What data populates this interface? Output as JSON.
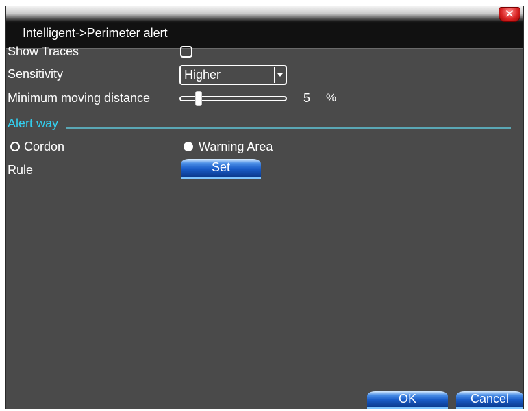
{
  "window": {
    "title": "Intelligent->Perimeter alert",
    "close_label": "✕"
  },
  "settings": {
    "show_traces": {
      "label": "Show Traces",
      "checked": false
    },
    "sensitivity": {
      "label": "Sensitivity",
      "value": "Higher"
    },
    "min_distance": {
      "label": "Minimum moving distance",
      "value": "5",
      "unit": "%",
      "level_percent": 5
    }
  },
  "alert_way": {
    "label": "Alert way",
    "options": [
      {
        "label": "Cordon",
        "selected": false
      },
      {
        "label": "Warning Area",
        "selected": true
      }
    ]
  },
  "rule": {
    "label": "Rule",
    "button_label": "Set"
  },
  "footer": {
    "ok_label": "OK",
    "cancel_label": "Cancel"
  },
  "colors": {
    "background": "#4a4a4a",
    "titlebar": "#111111",
    "section_accent": "#33d0f0",
    "button_blue": "#1a5cc8",
    "close_red": "#d61f1f"
  }
}
